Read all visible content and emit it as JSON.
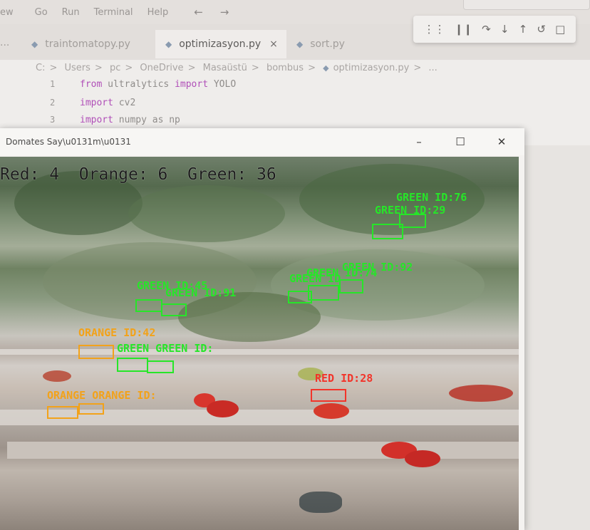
{
  "menubar": {
    "items": [
      "Go",
      "Run",
      "Terminal",
      "Help"
    ],
    "edge_item": "ew",
    "back_arrow": "←",
    "forward_arrow": "→"
  },
  "tabs": {
    "overflow": "...",
    "items": [
      {
        "label": "traintomatopy.py",
        "active": false
      },
      {
        "label": "optimizasyon.py",
        "active": true,
        "close": "×"
      },
      {
        "label": "sort.py",
        "active": false
      }
    ]
  },
  "debug_toolbar": {
    "icons": [
      "grip-icon",
      "pause-icon",
      "step-over-icon",
      "step-into-icon",
      "step-out-icon",
      "restart-icon",
      "stop-icon"
    ]
  },
  "breadcrumb": {
    "parts": [
      "C:",
      "Users",
      "pc",
      "OneDrive",
      "Masaüstü",
      "bombus"
    ],
    "file": "optimizasyon.py",
    "trail": "..."
  },
  "code": [
    {
      "num": "1",
      "kw1": "from",
      "mid": " ultralytics ",
      "kw2": "import",
      "rest": " YOLO"
    },
    {
      "num": "2",
      "kw1": "import",
      "mid": " cv2",
      "kw2": "",
      "rest": ""
    },
    {
      "num": "3",
      "kw1": "import",
      "mid": " numpy as np",
      "kw2": "",
      "rest": ""
    }
  ],
  "video_window": {
    "title": "Domates Say\\u0131m\\u0131",
    "minimize": "–",
    "maximize": "☐",
    "close": "✕"
  },
  "counts": {
    "text": "Red: 4  Orange: 6  Green: 36",
    "red": 4,
    "orange": 6,
    "green": 36
  },
  "detections": {
    "green_76": "GREEN ID:76",
    "green_29": "GREEN ID:29",
    "green_92": "GREEN ID:92",
    "green_74": "GREEN ID:74",
    "green_cluster": "GREEN ID",
    "green_45": "GREEN ID:45",
    "green_91": "GREEN ID:91",
    "orange_42": "ORANGE ID:42",
    "green_row": "GREEN GREEN ID:",
    "red_28": "RED ID:28",
    "orange_row": "ORANGE ORANGE ID:"
  },
  "colors": {
    "green": "#26e628",
    "orange": "#f2a21a",
    "red": "#f2342a"
  }
}
